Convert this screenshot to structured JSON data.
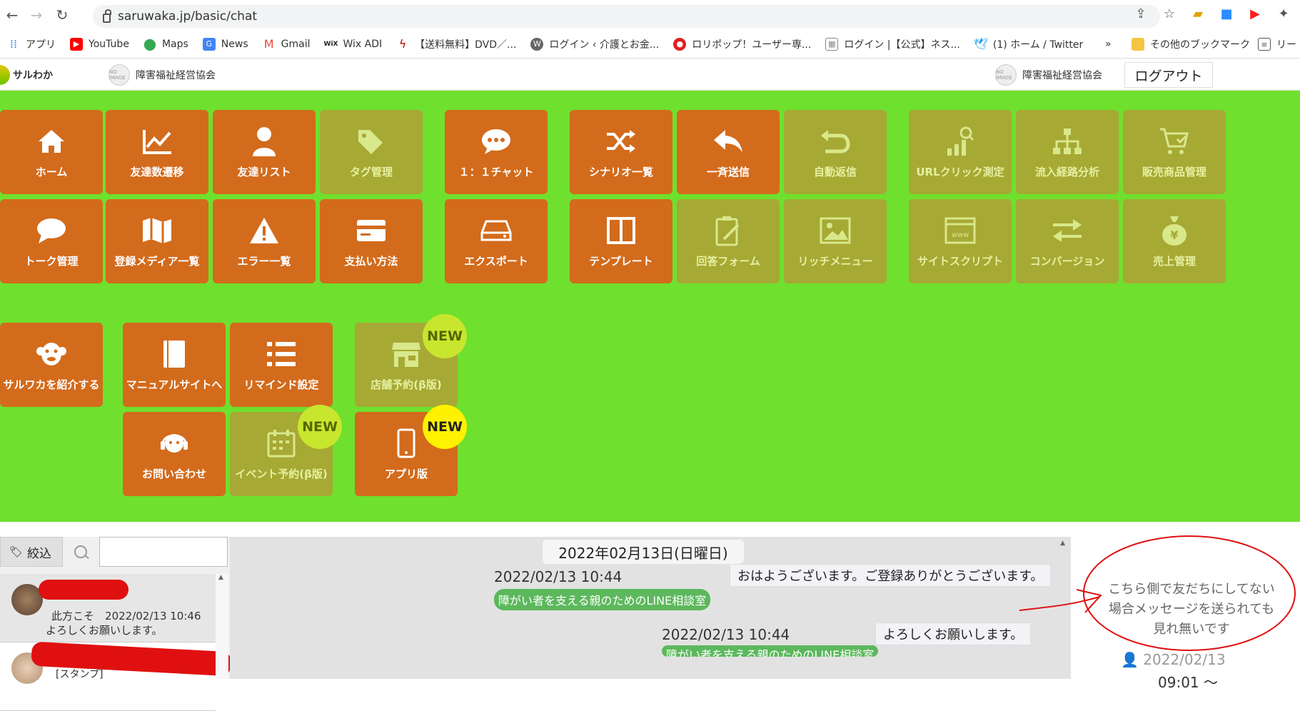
{
  "browser": {
    "url": "saruwaka.jp/basic/chat",
    "bookmarks": [
      {
        "label": "アプリ",
        "color": "#4285f4",
        "icon": "apps-grid-icon"
      },
      {
        "label": "YouTube",
        "color": "#ff0000",
        "icon": "youtube-icon"
      },
      {
        "label": "Maps",
        "color": "#34a853",
        "icon": "maps-pin-icon"
      },
      {
        "label": "News",
        "color": "#4285f4",
        "icon": "google-news-icon"
      },
      {
        "label": "Gmail",
        "color": "#ea4335",
        "icon": "gmail-icon"
      },
      {
        "label": "Wix ADI",
        "color": "#222222",
        "icon": "wix-icon"
      },
      {
        "label": "【送料無料】DVD／...",
        "color": "#c00000",
        "icon": "shop-icon"
      },
      {
        "label": "ログイン ‹ 介護とお金...",
        "color": "#666666",
        "icon": "wordpress-icon"
      },
      {
        "label": "ロリポップ！ユーザー専...",
        "color": "#e02020",
        "icon": "lolipop-icon"
      },
      {
        "label": "ログイン |【公式】ネス...",
        "color": "#888888",
        "icon": "page-icon"
      },
      {
        "label": "(1) ホーム / Twitter",
        "color": "#1da1f2",
        "icon": "twitter-icon"
      }
    ],
    "overflow": "»",
    "other_bookmarks": "その他のブックマーク",
    "reading_list": "リー"
  },
  "header": {
    "logo_text": "サルわか",
    "org_left": "障害福祉経営協会",
    "org_right": "障害福祉経営協会",
    "noimg_text": "NO IMAGE",
    "logout": "ログアウト"
  },
  "menu": {
    "home": "ホーム",
    "friend_trend": "友達数遷移",
    "friend_list": "友達リスト",
    "tag_manage": "タグ管理",
    "chat_1to1": "１：１チャット",
    "scenario": "シナリオ一覧",
    "broadcast": "一斉送信",
    "auto_reply": "自動返信",
    "url_click": "URLクリック測定",
    "inflow": "流入経路分析",
    "product": "販売商品管理",
    "talk": "トーク管理",
    "media": "登録メディア一覧",
    "errors": "エラー一覧",
    "payment": "支払い方法",
    "export": "エクスポート",
    "template": "テンプレート",
    "form": "回答フォーム",
    "rich_menu": "リッチメニュー",
    "site_script": "サイトスクリプト",
    "conversion": "コンバージョン",
    "sales": "売上管理",
    "introduce": "サルワカを紹介する",
    "manual": "マニュアルサイトへ",
    "remind": "リマインド設定",
    "store_reserve": "店舗予約(β版)",
    "contact": "お問い合わせ",
    "event_reserve": "イベント予約(β版)",
    "app_version": "アプリ版",
    "new_badge": "NEW"
  },
  "chat": {
    "filter_label": "絞込",
    "friends": [
      {
        "sender": "此方こそ",
        "time": "2022/02/13 10:46",
        "message": "よろしくお願いします。"
      },
      {
        "message": "[スタンプ]"
      }
    ],
    "date_header": "2022年02月13日(日曜日)",
    "messages": [
      {
        "time": "2022/02/13 10:44",
        "text": "おはようございます。ご登録ありがとうございます。",
        "tag": "障がい者を支える親のためのLINE相談室"
      },
      {
        "time": "2022/02/13 10:44",
        "text": "よろしくお願いします。",
        "tag": "障がい者を支える親のためのLINE相談室"
      }
    ],
    "right_note": "こちら側で友だちにしてない場合メッセージを送られても見れ無いです",
    "right_date": "2022/02/13",
    "right_time": "09:01 ～"
  },
  "colors": {
    "menu_bg": "#6fe02d",
    "tile_active": "#d36b1c",
    "tile_disabled": "#a7a935",
    "annotation_red": "#e01010"
  }
}
